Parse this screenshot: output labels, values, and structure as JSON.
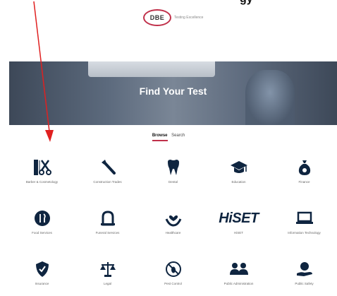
{
  "top": {
    "clipped_text": "gy"
  },
  "logo": {
    "mark": "DBE",
    "tagline": "Testing Excellence"
  },
  "hero": {
    "title": "Find Your Test"
  },
  "tabs": [
    {
      "label": "Browse",
      "active": true
    },
    {
      "label": "Search",
      "active": false
    }
  ],
  "categories": [
    {
      "label": "Barber & Cosmetology",
      "icon": "scissors-comb-icon"
    },
    {
      "label": "Construction Trades",
      "icon": "wrench-icon"
    },
    {
      "label": "Dental",
      "icon": "tooth-icon"
    },
    {
      "label": "Education",
      "icon": "graduation-cap-icon"
    },
    {
      "label": "Finance",
      "icon": "money-bag-icon"
    },
    {
      "label": "Food Services",
      "icon": "utensils-icon"
    },
    {
      "label": "Funeral Services",
      "icon": "monument-icon"
    },
    {
      "label": "Healthcare",
      "icon": "heart-hand-icon"
    },
    {
      "label": "HiSET",
      "icon": "hiset-logo"
    },
    {
      "label": "Information Technology",
      "icon": "laptop-icon"
    },
    {
      "label": "Insurance",
      "icon": "shield-check-icon"
    },
    {
      "label": "Legal",
      "icon": "scales-icon"
    },
    {
      "label": "Pest Control",
      "icon": "no-bug-icon"
    },
    {
      "label": "Public Administration",
      "icon": "people-icon"
    },
    {
      "label": "Public Safety",
      "icon": "hand-globe-icon"
    }
  ],
  "colors": {
    "icon": "#0f2540",
    "accent": "#c0304a",
    "annotation_arrow": "#e02020"
  }
}
